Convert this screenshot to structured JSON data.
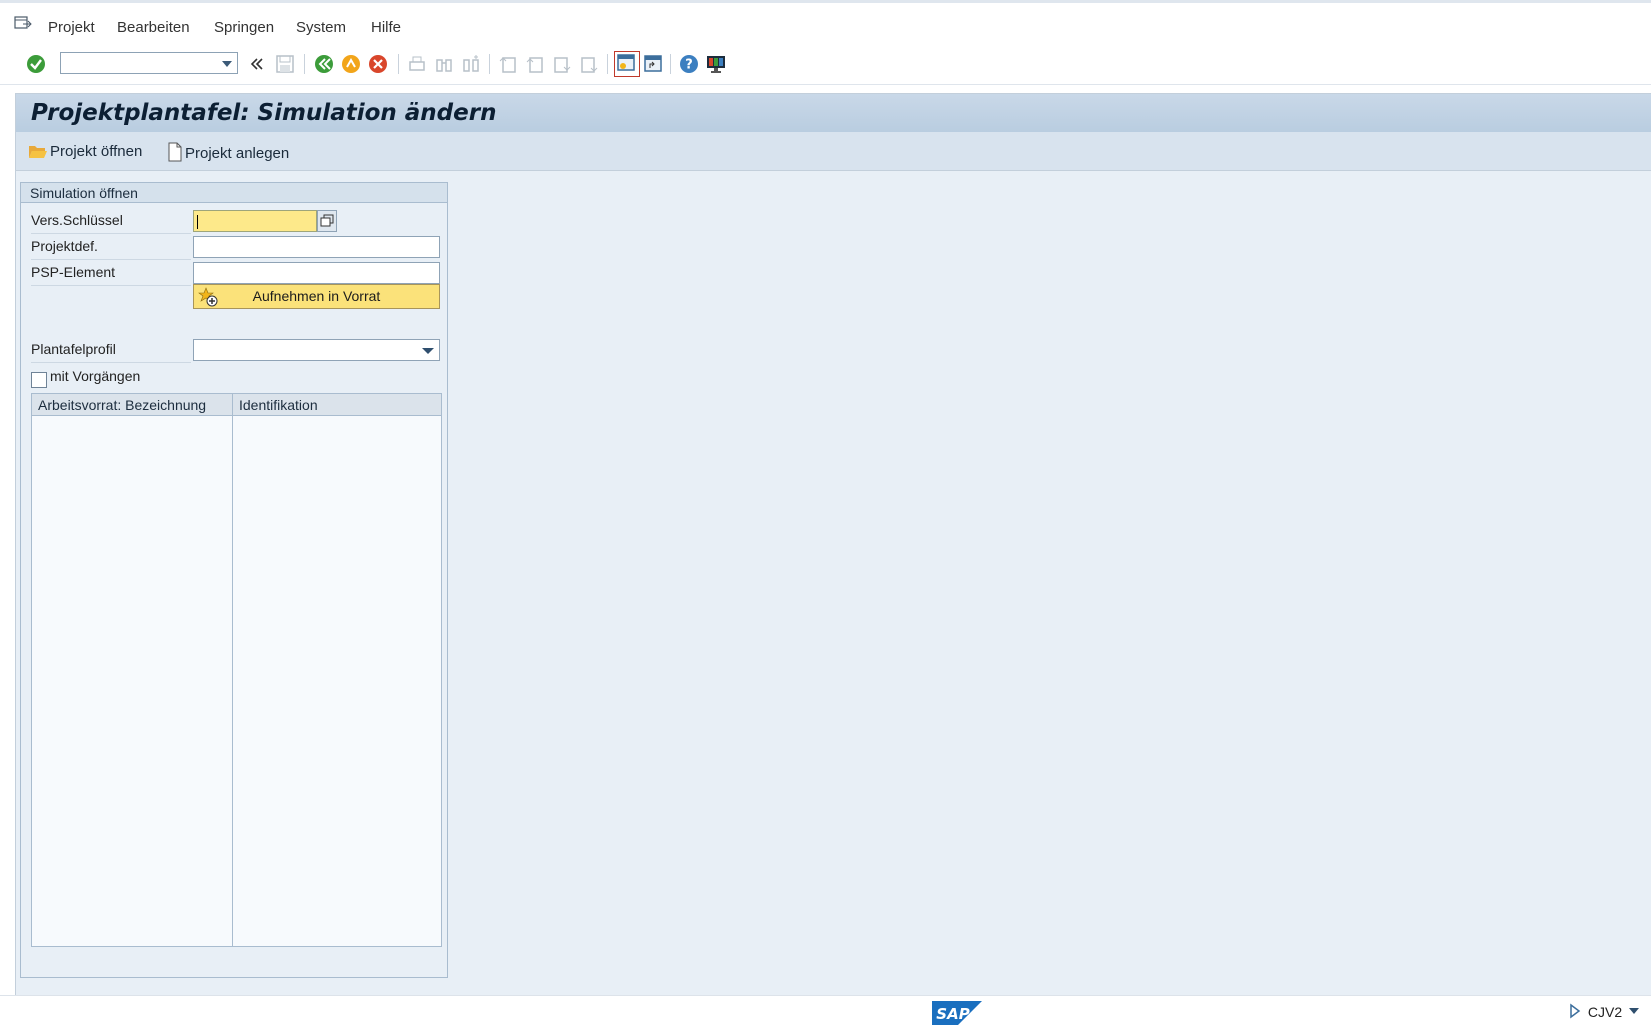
{
  "menu": {
    "items": [
      {
        "label": "Projekt"
      },
      {
        "label": "Bearbeiten"
      },
      {
        "label": "Springen"
      },
      {
        "label": "System"
      },
      {
        "label": "Hilfe"
      }
    ]
  },
  "toolbar": {
    "command_field_value": "",
    "icons": [
      "enter-check-icon",
      "command-dropdown",
      "expand-icon",
      "save-icon",
      "back-icon",
      "exit-icon",
      "cancel-icon",
      "print-icon",
      "find-icon",
      "find-next-icon",
      "first-page-icon",
      "previous-page-icon",
      "next-page-icon",
      "last-page-icon",
      "new-session-icon",
      "shortcut-icon",
      "help-icon",
      "customize-layout-icon"
    ]
  },
  "page": {
    "title": "Projektplantafel: Simulation ändern"
  },
  "app_toolbar": {
    "open_project": "Projekt öffnen",
    "create_project": "Projekt anlegen"
  },
  "group": {
    "title": "Simulation öffnen",
    "fields": {
      "version_key_label": "Vers.Schlüssel",
      "version_key_value": "",
      "project_def_label": "Projektdef.",
      "project_def_value": "",
      "wbs_label": "PSP-Element",
      "wbs_value": "",
      "add_button": "Aufnehmen in Vorrat",
      "profile_label": "Plantafelprofil",
      "profile_value": "",
      "with_activities_label": "mit Vorgängen",
      "with_activities_checked": false
    },
    "table": {
      "columns": [
        "Arbeitsvorrat: Bezeichnung",
        "Identifikation"
      ],
      "rows": []
    }
  },
  "status_bar": {
    "logo": "SAP",
    "transaction": "CJV2"
  },
  "colors": {
    "required_field": "#fde98a",
    "background": "#e8eff6",
    "title_bar": "#c9d8e8"
  }
}
